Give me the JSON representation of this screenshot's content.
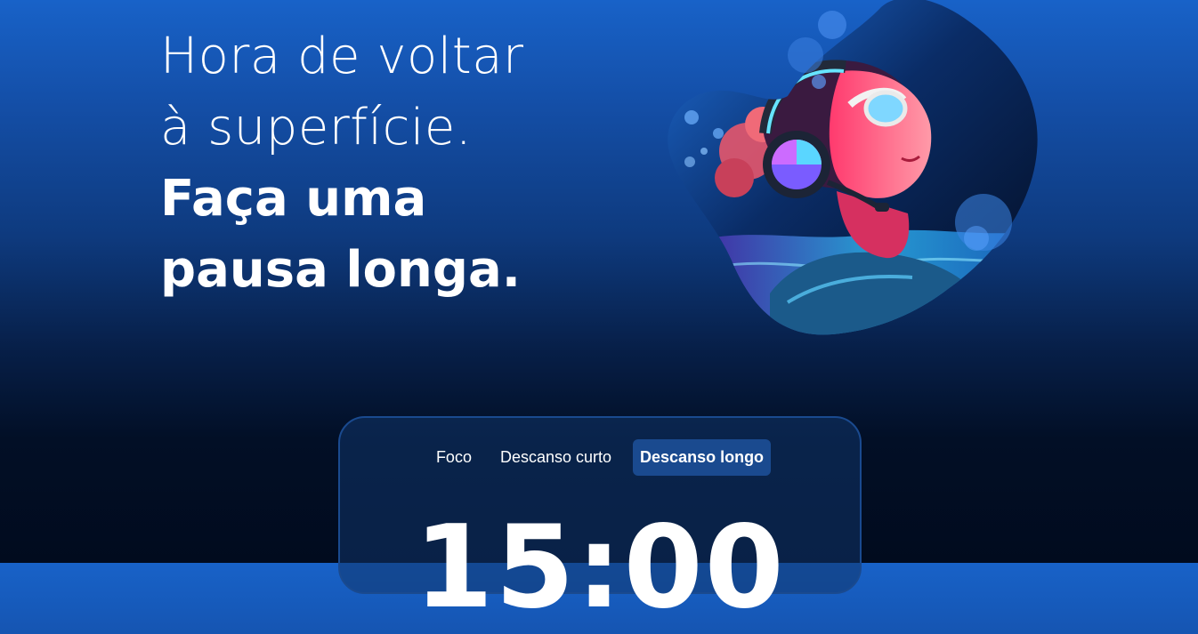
{
  "headline": {
    "line1": "Hora de voltar",
    "line2": "à superfície.",
    "line3": "Faça uma",
    "line4": "pausa longa."
  },
  "tabs": [
    {
      "label": "Foco",
      "active": false
    },
    {
      "label": "Descanso curto",
      "active": false
    },
    {
      "label": "Descanso longo",
      "active": true
    }
  ],
  "timer": {
    "value": "15:00"
  },
  "colors": {
    "background_top": "#1862c8",
    "background_bottom": "#010b1e",
    "card_border": "#1a4a8f",
    "active_tab": "#1a4a8f",
    "text": "#ffffff"
  },
  "hero_image": {
    "icon": "diver-with-headphones-image"
  }
}
